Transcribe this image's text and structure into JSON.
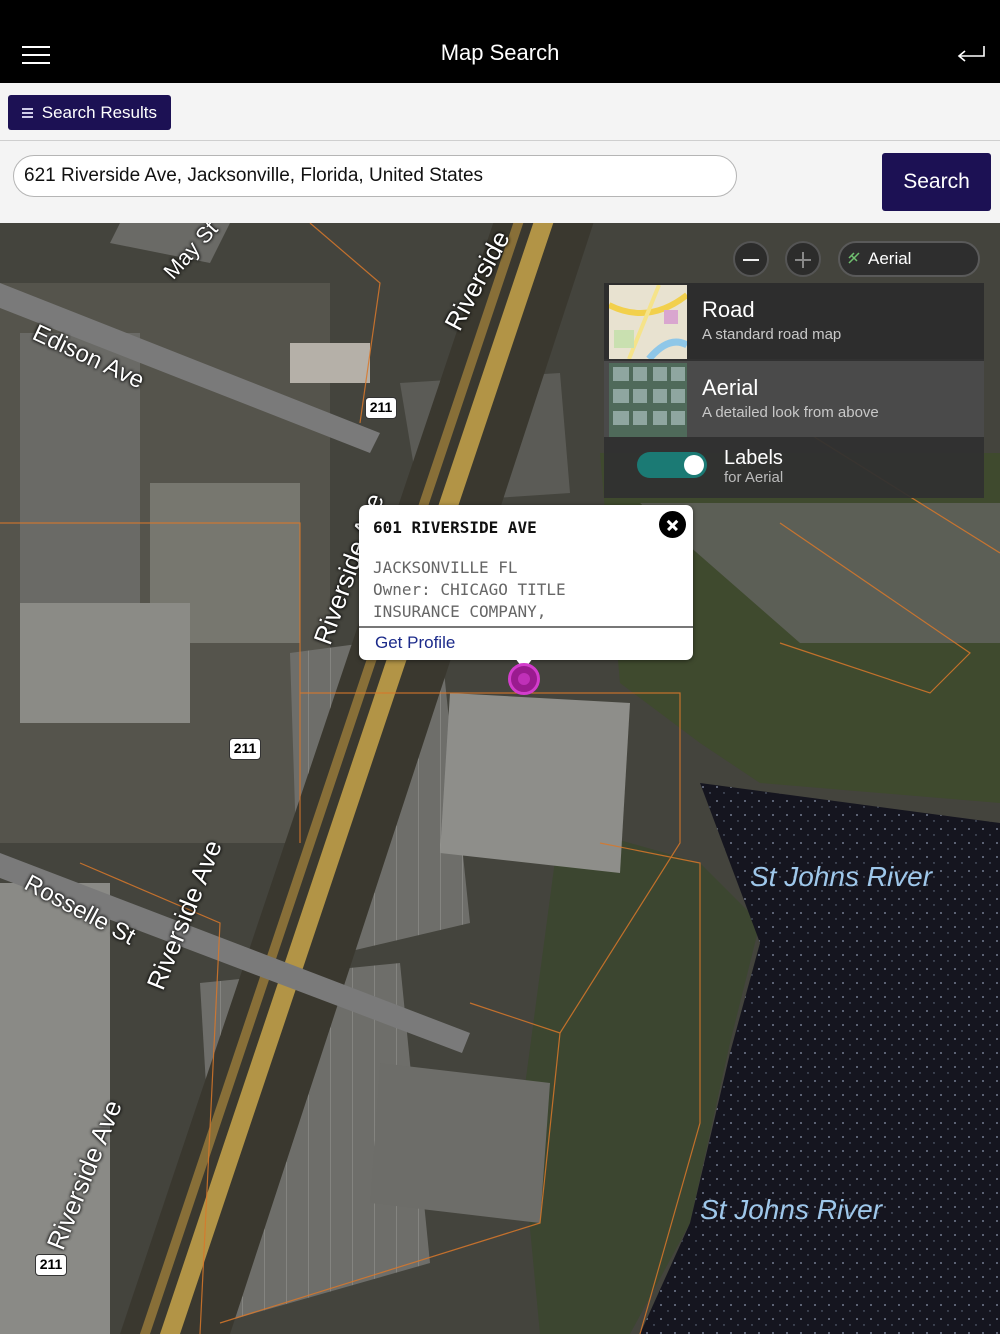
{
  "header": {
    "title": "Map Search",
    "menu_icon": "hamburger-menu-icon",
    "back_icon": "return-arrow-icon"
  },
  "results": {
    "button_label": "Search Results",
    "icon": "list-icon"
  },
  "search": {
    "value": "621 Riverside Ave, Jacksonville, Florida, United States",
    "button_label": "Search"
  },
  "map_controls": {
    "current_style": "Aerial",
    "zoom_out_icon": "minus-icon",
    "zoom_in_icon": "plus-icon"
  },
  "style_panel": {
    "options": [
      {
        "name": "Road",
        "desc": "A standard road map"
      },
      {
        "name": "Aerial",
        "desc": "A detailed look from above"
      }
    ],
    "labels": {
      "name": "Labels",
      "sub": "for Aerial",
      "enabled": true
    }
  },
  "popup": {
    "title": "601 RIVERSIDE AVE",
    "lines": [
      "JACKSONVILLE FL",
      "Owner: CHICAGO TITLE",
      "INSURANCE COMPANY,"
    ],
    "link": "Get Profile"
  },
  "map_labels": {
    "streets": [
      "May St",
      "Riverside",
      "Edison Ave",
      "Riverside Ave",
      "Riverside Ave",
      "Rosselle St",
      "Riverside Ave"
    ],
    "route_shields": [
      "211",
      "211",
      "211"
    ],
    "water": [
      "St Johns River",
      "St Johns River"
    ]
  },
  "colors": {
    "primary": "#1c1154",
    "toggle_on": "#1b7a74",
    "pin": "#9a1b8f",
    "link": "#1b2a8a"
  }
}
